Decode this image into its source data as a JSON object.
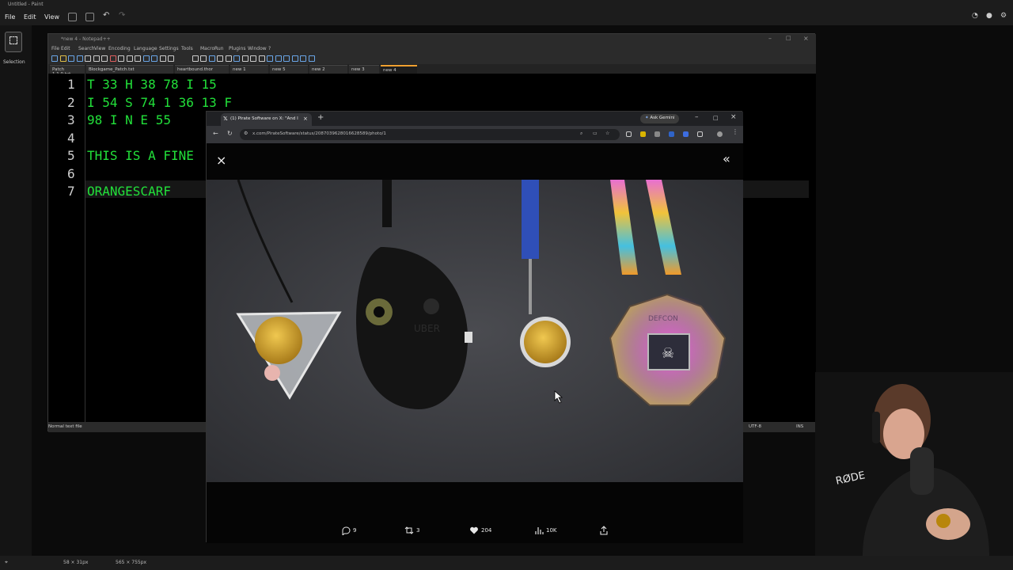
{
  "paint": {
    "title": "Untitled - Paint",
    "menu": [
      "File",
      "Edit",
      "View"
    ],
    "tool_label": "Selection",
    "status_selection": "58 × 31px",
    "status_canvas": "565 × 755px"
  },
  "notepad": {
    "title": "*new 4 - Notepad++",
    "menu": [
      "File",
      "Edit",
      "Search",
      "View",
      "Encoding",
      "Language",
      "Settings",
      "Tools",
      "Macro",
      "Run",
      "Plugins",
      "Window",
      "?"
    ],
    "tabs": [
      "Patch 1.1.0.txt",
      "Blockgame_Patch.txt",
      "heartbound.thor",
      "new 1",
      "new 5",
      "new 2",
      "new 3",
      "new 4"
    ],
    "lines": [
      {
        "num": "1",
        "text": "T 33 H 38 78 I 15"
      },
      {
        "num": "2",
        "text": "I 54 S 74 1 36 13 F"
      },
      {
        "num": "3",
        "text": "98 I N E 55"
      },
      {
        "num": "4",
        "text": ""
      },
      {
        "num": "5",
        "text": "THIS IS A FINE"
      },
      {
        "num": "6",
        "text": ""
      },
      {
        "num": "7",
        "text": "ORANGESCARF"
      }
    ],
    "status_left": "Normal text file",
    "status_encoding": "UTF-8",
    "status_mode": "INS"
  },
  "browser": {
    "tab_title": "(1) Pirate Software on X: \"And I",
    "url": "x.com/PirateSoftware/status/2087039628016628589/photo/1",
    "ask_gemini": "Ask Gemini"
  },
  "post": {
    "replies": "9",
    "reposts": "3",
    "likes": "204",
    "views": "10K"
  },
  "colors": {
    "code_green": "#22e03a",
    "active_tab_accent": "#f0a030",
    "like_red": "#f91880"
  }
}
